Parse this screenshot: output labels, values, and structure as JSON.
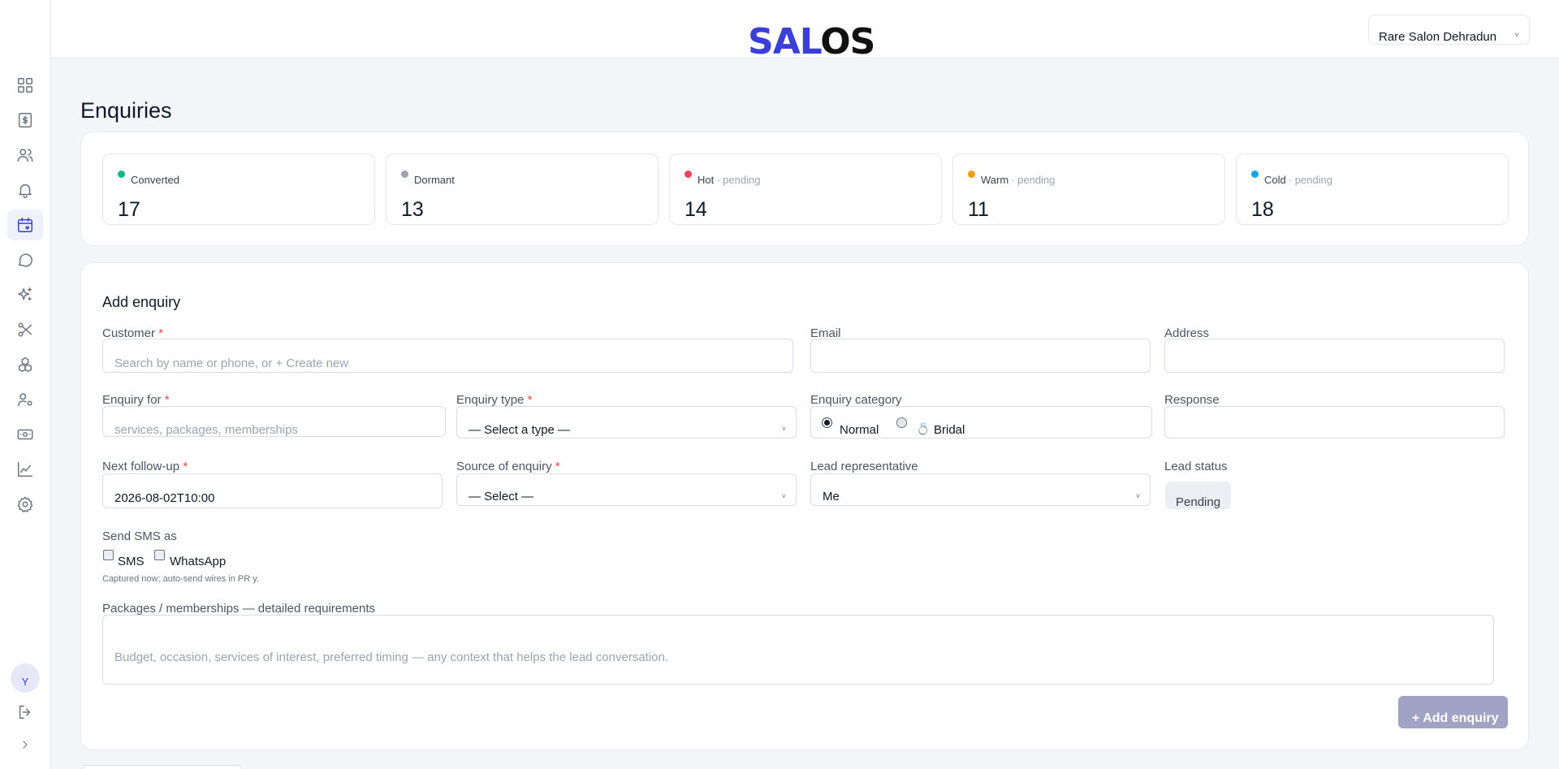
{
  "app": {
    "logo_part1": "SAL",
    "logo_part2": "OS",
    "salon_selected": "Rare Salon Dehradun"
  },
  "sidebar": {
    "avatar_initial": "Y",
    "items": [
      {
        "icon": "dashboard-icon"
      },
      {
        "icon": "billing-icon"
      },
      {
        "icon": "users-icon"
      },
      {
        "icon": "bell-icon"
      },
      {
        "icon": "calendar-heart-icon",
        "active": true
      },
      {
        "icon": "chat-icon"
      },
      {
        "icon": "sparkles-icon"
      },
      {
        "icon": "scissors-icon"
      },
      {
        "icon": "packages-icon"
      },
      {
        "icon": "staff-settings-icon"
      },
      {
        "icon": "cash-icon"
      },
      {
        "icon": "analytics-icon"
      },
      {
        "icon": "settings-icon"
      }
    ],
    "logout_icon": "logout-icon",
    "expand_icon": "chevron-right-icon"
  },
  "page": {
    "title": "Enquiries"
  },
  "stats": [
    {
      "label": "Converted",
      "sub": "",
      "value": "17",
      "color": "#10b981"
    },
    {
      "label": "Dormant",
      "sub": "",
      "value": "13",
      "color": "#9ca3af"
    },
    {
      "label": "Hot",
      "sub": "· pending",
      "value": "14",
      "color": "#f43f5e"
    },
    {
      "label": "Warm",
      "sub": "· pending",
      "value": "11",
      "color": "#f59e0b"
    },
    {
      "label": "Cold",
      "sub": "· pending",
      "value": "18",
      "color": "#0ea5e9"
    }
  ],
  "form": {
    "title": "Add enquiry",
    "customer": {
      "label": "Customer",
      "required": "*",
      "placeholder": "Search by name or phone, or + Create new"
    },
    "email": {
      "label": "Email",
      "value": ""
    },
    "address": {
      "label": "Address",
      "value": ""
    },
    "enquiry_for": {
      "label": "Enquiry for",
      "required": "*",
      "placeholder": "services, packages, memberships"
    },
    "enquiry_type": {
      "label": "Enquiry type",
      "required": "*",
      "value": "— Select a type —"
    },
    "enquiry_category": {
      "label": "Enquiry category",
      "options": [
        "Normal",
        "Bridal"
      ],
      "selected": "Normal",
      "bridal_icon": "💍"
    },
    "response": {
      "label": "Response",
      "value": ""
    },
    "next_followup": {
      "label": "Next follow-up",
      "required": "*",
      "value": "2026-08-02T10:00"
    },
    "source": {
      "label": "Source of enquiry",
      "required": "*",
      "value": "— Select —"
    },
    "lead_rep": {
      "label": "Lead representative",
      "value": "Me"
    },
    "lead_status": {
      "label": "Lead status",
      "value": "Pending"
    },
    "send_sms": {
      "label": "Send SMS as",
      "options": [
        "SMS",
        "WhatsApp"
      ],
      "hint": "Captured now; auto-send wires in PR y."
    },
    "requirements": {
      "label": "Packages / memberships — detailed requirements",
      "placeholder": "Budget, occasion, services of interest, preferred timing — any context that helps the lead conversation."
    },
    "submit": "+ Add enquiry"
  }
}
